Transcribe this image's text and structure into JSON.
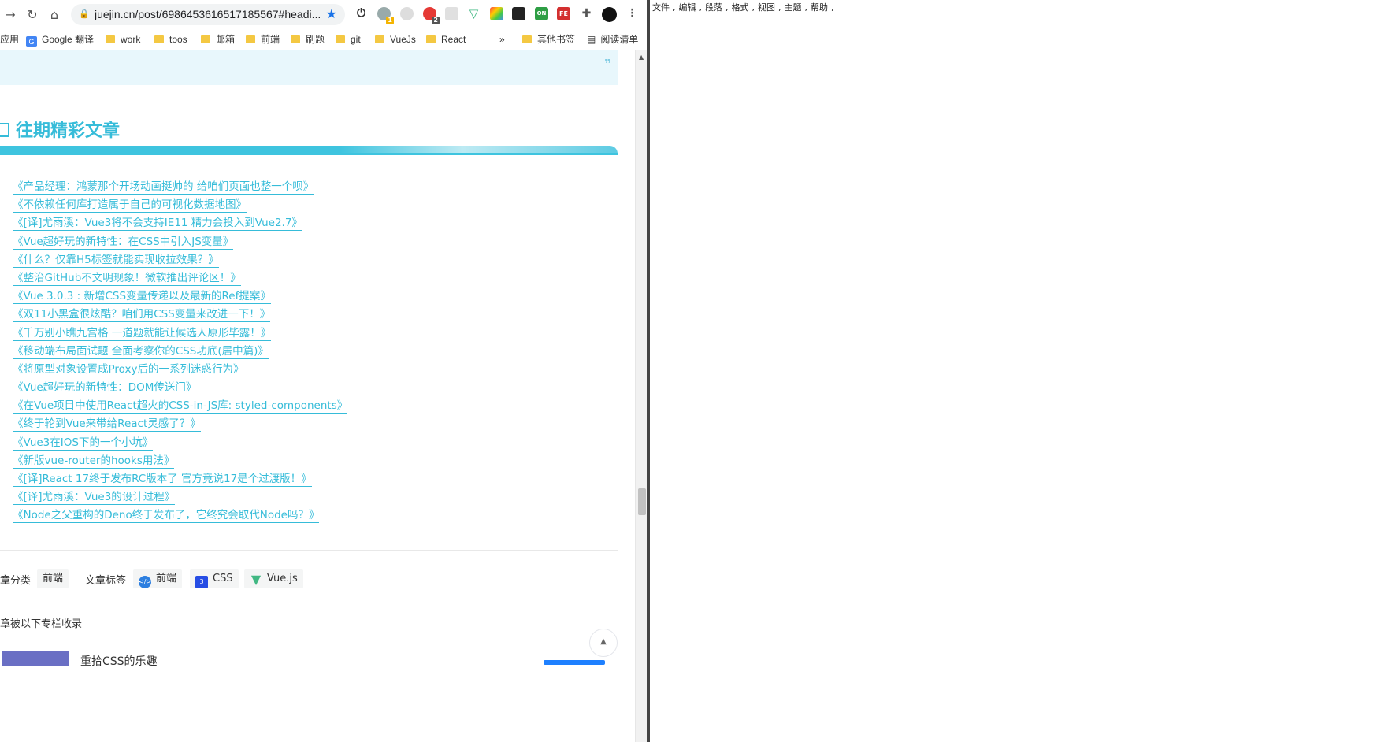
{
  "browser": {
    "url": "juejin.cn/post/6986453616517185567#headi...",
    "extensions": [
      {
        "name": "power-icon",
        "badge": ""
      },
      {
        "name": "extension-1-icon",
        "badge": "1"
      },
      {
        "name": "extension-2-icon",
        "badge": ""
      },
      {
        "name": "extension-3-icon",
        "badge": "2"
      },
      {
        "name": "extension-4-icon",
        "badge": ""
      },
      {
        "name": "vue-devtools-icon",
        "badge": ""
      },
      {
        "name": "color-picker-icon",
        "badge": ""
      },
      {
        "name": "ghost-icon",
        "badge": ""
      },
      {
        "name": "on-icon",
        "badge": "ON"
      },
      {
        "name": "fe-icon",
        "badge": "FE"
      },
      {
        "name": "puzzle-icon",
        "badge": ""
      },
      {
        "name": "profile-icon",
        "badge": ""
      }
    ]
  },
  "bookmarks": {
    "apps": "应用",
    "items": [
      "Google 翻译",
      "work",
      "toos",
      "邮箱",
      "前端",
      "刷题",
      "git",
      "VueJs",
      "React"
    ],
    "more": "»",
    "other": "其他书签",
    "reading_list": "阅读清单"
  },
  "article": {
    "quote_mark": "❞",
    "section_title": "往期精彩文章",
    "links": [
      "《产品经理：鸿蒙那个开场动画挺帅的 给咱们页面也整一个呗》",
      "《不依赖任何库打造属于自己的可视化数据地图》",
      "《[译]尤雨溪：Vue3将不会支持IE11 精力会投入到Vue2.7》",
      "《Vue超好玩的新特性：在CSS中引入JS变量》",
      "《什么？仅靠H5标签就能实现收拉效果？》",
      "《整治GitHub不文明现象！微软推出评论区！》",
      "《Vue 3.0.3 : 新增CSS变量传递以及最新的Ref提案》",
      "《双11小黑盒很炫酷？咱们用CSS变量来改进一下！》",
      "《千万别小瞧九宫格 一道题就能让候选人原形毕露！》",
      "《移动端布局面试题 全面考察你的CSS功底(居中篇)》",
      "《将原型对象设置成Proxy后的一系列迷惑行为》",
      "《Vue超好玩的新特性：DOM传送门》",
      "《在Vue项目中使用React超火的CSS-in-JS库: styled-components》",
      "《终于轮到Vue来带给React灵感了？》",
      "《Vue3在IOS下的一个小坑》",
      "《新版vue-router的hooks用法》",
      "《[译]React 17终于发布RC版本了 官方竟说17是个过渡版！》",
      "《[译]尤雨溪：Vue3的设计过程》",
      "《Node之父重构的Deno终于发布了，它终究会取代Node吗？》"
    ],
    "category_label": "章分类",
    "category": "前端",
    "tags_label": "文章标签",
    "tags": [
      "前端",
      "CSS",
      "Vue.js"
    ],
    "collected_label": "章被以下专栏收录",
    "column_title": "重拾CSS的乐趣",
    "back_to_top": "▲"
  },
  "editor": {
    "menu": [
      "文件",
      "编辑",
      "段落",
      "格式",
      "视图",
      "主题",
      "帮助"
    ]
  }
}
